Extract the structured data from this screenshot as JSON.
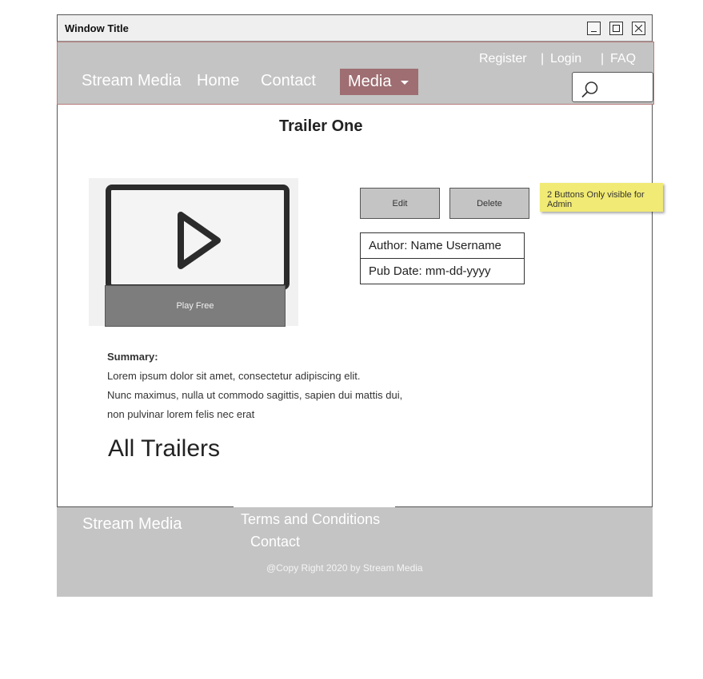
{
  "window": {
    "title": "Window Title"
  },
  "nav": {
    "brand": "Stream Media",
    "home": "Home",
    "contact": "Contact",
    "media": "Media",
    "register": "Register",
    "login": "Login",
    "faq": "FAQ",
    "separator": "|"
  },
  "page": {
    "title": "Trailer One"
  },
  "player": {
    "play_label": "Play Free"
  },
  "admin": {
    "edit": "Edit",
    "delete": "Delete",
    "note": "2 Buttons Only visible for Admin"
  },
  "meta": {
    "author": "Author: Name Username",
    "pub_date": "Pub Date: mm-dd-yyyy"
  },
  "summary": {
    "heading": "Summary:",
    "lines": [
      "Lorem ipsum dolor sit amet, consectetur adipiscing elit.",
      "Nunc maximus, nulla ut commodo sagittis, sapien dui mattis dui,",
      "non pulvinar lorem felis nec erat"
    ]
  },
  "section": {
    "all_trailers": "All Trailers"
  },
  "footer": {
    "brand": "Stream Media",
    "terms": "Terms and Conditions",
    "contact": "Contact",
    "copyright": "@Copy Right 2020 by Stream Media"
  },
  "colors": {
    "navbar": "#c4c4c4",
    "media_button": "#9e6e72",
    "sticky_note": "#f1ea74",
    "play_button": "#7d7d7d"
  }
}
